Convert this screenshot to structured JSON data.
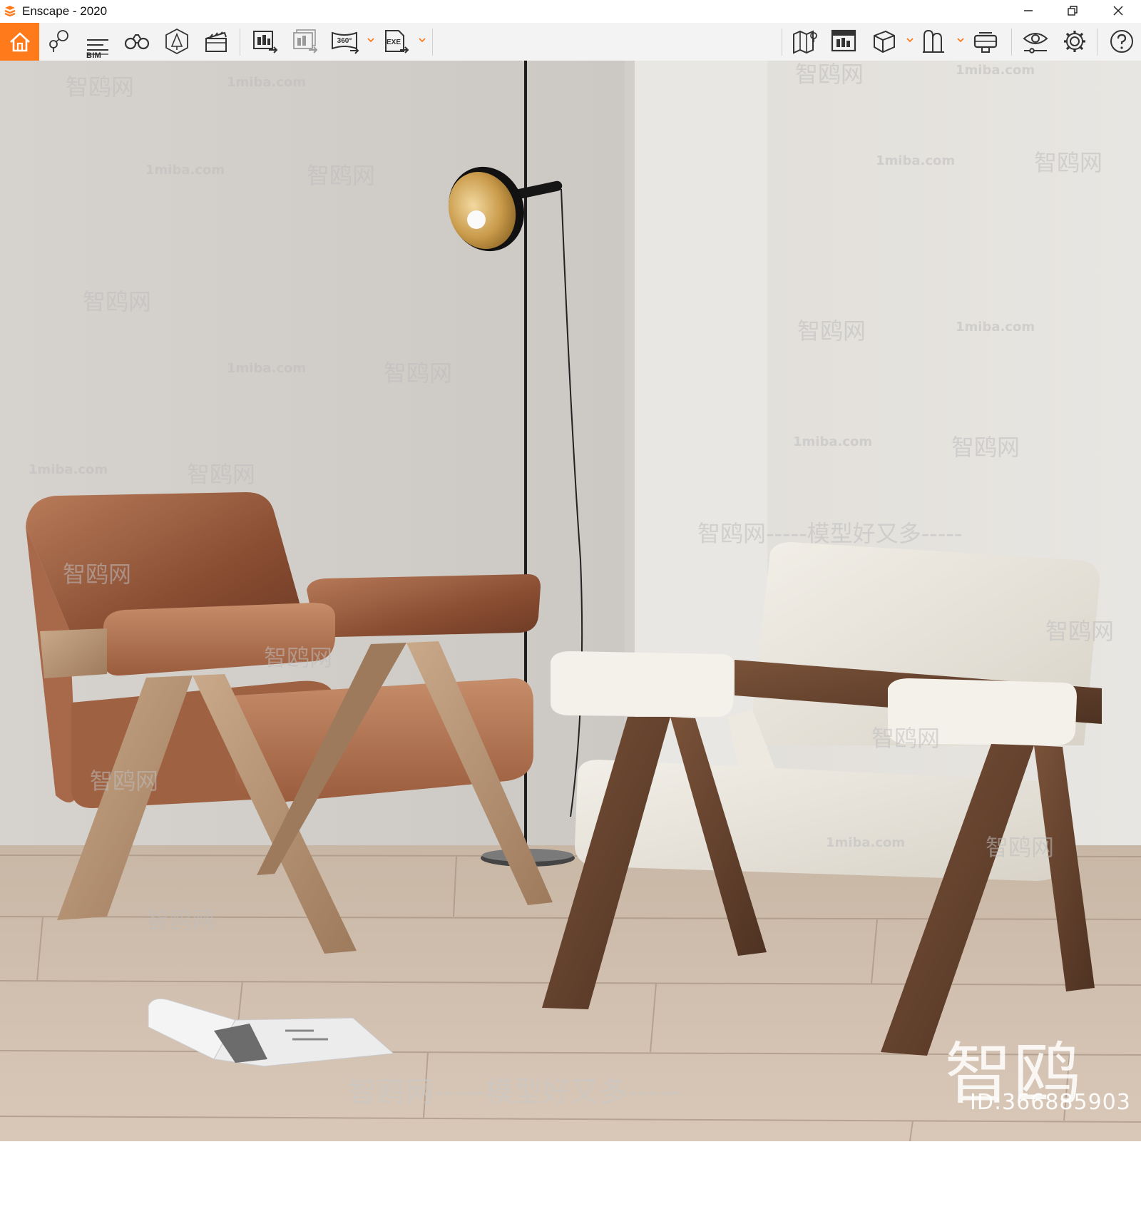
{
  "window": {
    "title": "Enscape - 2020",
    "accent_color": "#ff7a1a"
  },
  "toolbar": {
    "bim_label": "BIM",
    "panorama_label": "360°",
    "exe_label": "EXE",
    "icons": [
      "home-icon",
      "location-pins-icon",
      "bim-info-icon",
      "binoculars-icon",
      "view-management-icon",
      "video-editor-icon",
      "screenshot-export-icon",
      "batch-render-icon",
      "panorama-icon",
      "exe-export-icon",
      "map-icon",
      "asset-library-icon",
      "cube-icon",
      "material-editor-icon",
      "vr-headset-icon",
      "visual-settings-icon",
      "settings-icon",
      "help-icon"
    ]
  },
  "watermarks": {
    "site": "1miba.com",
    "brand_cn": "智鸥网",
    "slogan": "智鸥网-----模型好又多-----",
    "brand_big": "智鸥网",
    "id_text": "ID:366885903"
  }
}
